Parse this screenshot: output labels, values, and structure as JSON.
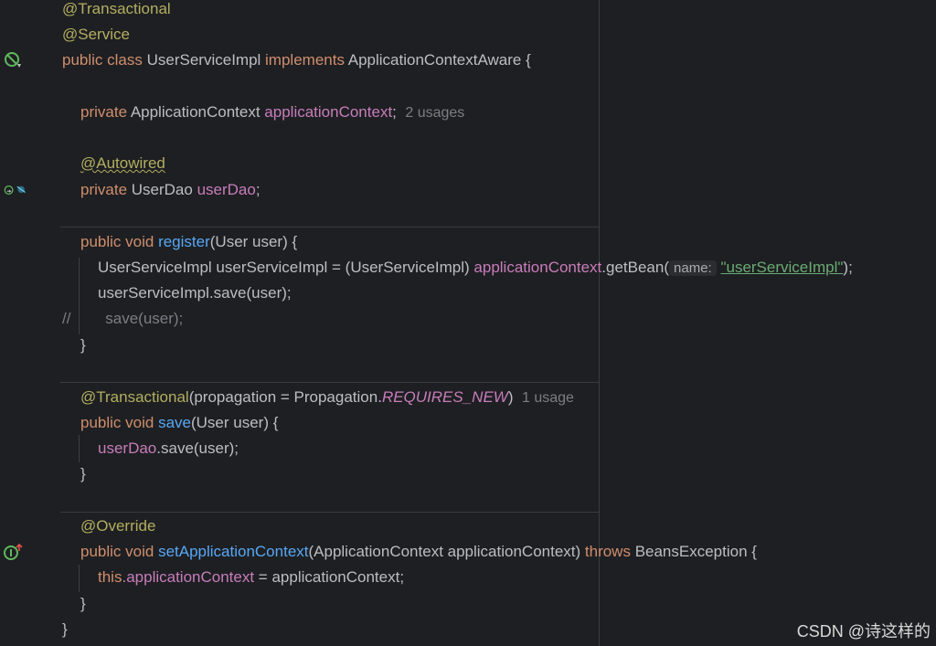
{
  "code": {
    "ann_transactional": "@Transactional",
    "ann_service": "@Service",
    "kw_public_class": "public class ",
    "class_name": "UserServiceImpl ",
    "kw_implements": "implements ",
    "iface_brace": "ApplicationContextAware {",
    "kw_private": "private ",
    "type_appctx": "ApplicationContext ",
    "field_appctx": "applicationContext",
    "semicolon": ";",
    "hint_2_usages": "2 usages",
    "ann_autowired": "@Autowired",
    "type_userdao": "UserDao ",
    "field_userdao": "userDao",
    "kw_public_void": "public void ",
    "fn_register": "register",
    "params_user": "(User user) {",
    "reg_line1_a": "UserServiceImpl userServiceImpl = (UserServiceImpl) ",
    "reg_line1_b": ".getBean(",
    "hint_name": "name:",
    "str_bean": "\"userServiceImpl\"",
    "close_paren_semi": ");",
    "reg_line2": "userServiceImpl.save(user);",
    "comment_slashes": "//",
    "comment_body": "save(user);",
    "close_brace": "}",
    "ann_transactional_prop": "@Transactional",
    "prop_text_a": "(propagation = Propagation.",
    "prop_requires_new": "REQUIRES_NEW",
    "prop_close": ")",
    "hint_1_usage": "1 usage",
    "fn_save": "save",
    "save_body_tail": ".save(user);",
    "ann_override": "@Override",
    "fn_setappctx": "setApplicationContext",
    "setappctx_params": "(ApplicationContext applicationContext) ",
    "kw_throws": "throws ",
    "exception_brace": "BeansException {",
    "kw_this": "this",
    "dot": ".",
    "assign_tail": " = applicationContext;"
  },
  "watermark": "CSDN @诗这样的",
  "icons": [
    "spring-bean-icon",
    "spring-autowire-icon",
    "implements-method-icon"
  ],
  "colors": {
    "background": "#1e1f22",
    "keyword": "#cf8e6d",
    "annotation": "#b3ae60",
    "field": "#c77dbb",
    "function": "#56a8f5",
    "string": "#6aab73",
    "text": "#bcbec4",
    "hint": "#7a7e85"
  }
}
